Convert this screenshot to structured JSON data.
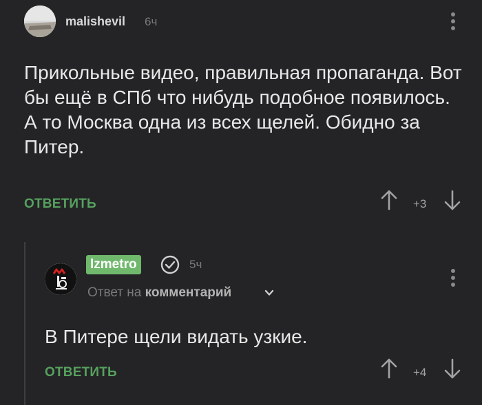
{
  "comment1": {
    "username": "malishevil",
    "time": "6ч",
    "text": "Прикольные видео, правильная пропаганда. Вот бы ещё в СПб что нибудь подобное появилось. А то Москва одна из всех щелей. Обидно за Питер.",
    "reply_label": "ОТВЕТИТЬ",
    "score": "+3"
  },
  "comment2": {
    "username": "lzmetro",
    "time": "5ч",
    "reply_to_prefix": "Ответ на",
    "reply_to_target": "комментарий",
    "text": "В Питере щели видать узкие.",
    "reply_label": "ОТВЕТИТЬ",
    "score": "+4"
  },
  "colors": {
    "background": "#242426",
    "accent_green": "#56a15e",
    "badge_green": "#6fb86c",
    "metro_red": "#d22020"
  },
  "icons": {
    "menu": "kebab-menu-icon",
    "upvote": "arrow-up-icon",
    "downvote": "arrow-down-icon",
    "verified": "check-circle-icon",
    "expand": "chevron-down-icon"
  }
}
